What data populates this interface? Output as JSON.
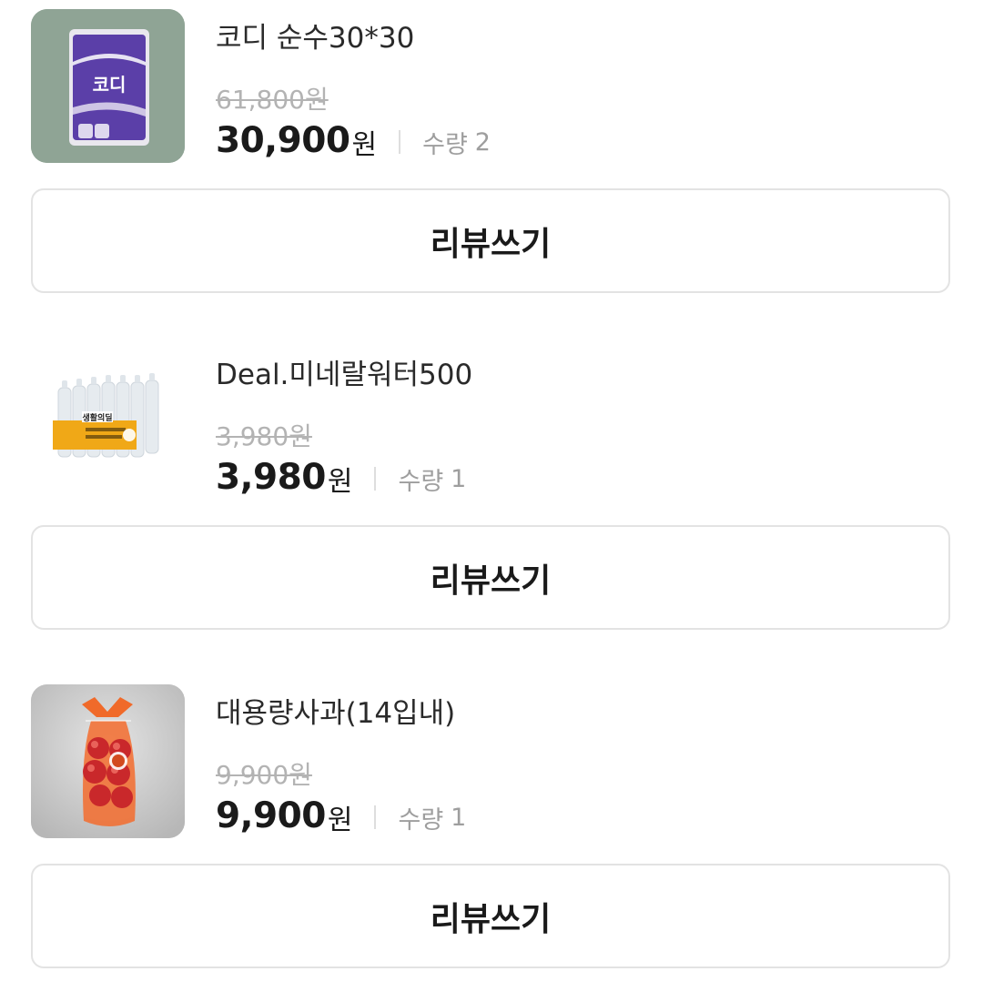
{
  "orders": [
    {
      "name": "코디 순수30*30",
      "original_price": "61,800원",
      "sale_price": "30,900",
      "price_unit": "원",
      "qty_label": "수량",
      "qty": "2",
      "review_label": "리뷰쓰기",
      "thumb_icon": "toilet-paper-pack-image",
      "thumb_text": "코디"
    },
    {
      "name": "Deal.미네랄워터500",
      "original_price": "3,980원",
      "sale_price": "3,980",
      "price_unit": "원",
      "qty_label": "수량",
      "qty": "1",
      "review_label": "리뷰쓰기",
      "thumb_icon": "water-bottle-pack-image",
      "thumb_text": "생활의딜"
    },
    {
      "name": "대용량사과(14입내)",
      "original_price": "9,900원",
      "sale_price": "9,900",
      "price_unit": "원",
      "qty_label": "수량",
      "qty": "1",
      "review_label": "리뷰쓰기",
      "thumb_icon": "apple-bag-image",
      "thumb_text": ""
    }
  ],
  "colors": {
    "text_primary": "#1a1a1a",
    "text_muted": "#9e9e9e",
    "strike": "#b3b3b3",
    "border": "#e3e3e3",
    "purple_brand": "#5b3fa8",
    "water_label": "#f0a817",
    "apple_bag": "#f06a2a"
  }
}
